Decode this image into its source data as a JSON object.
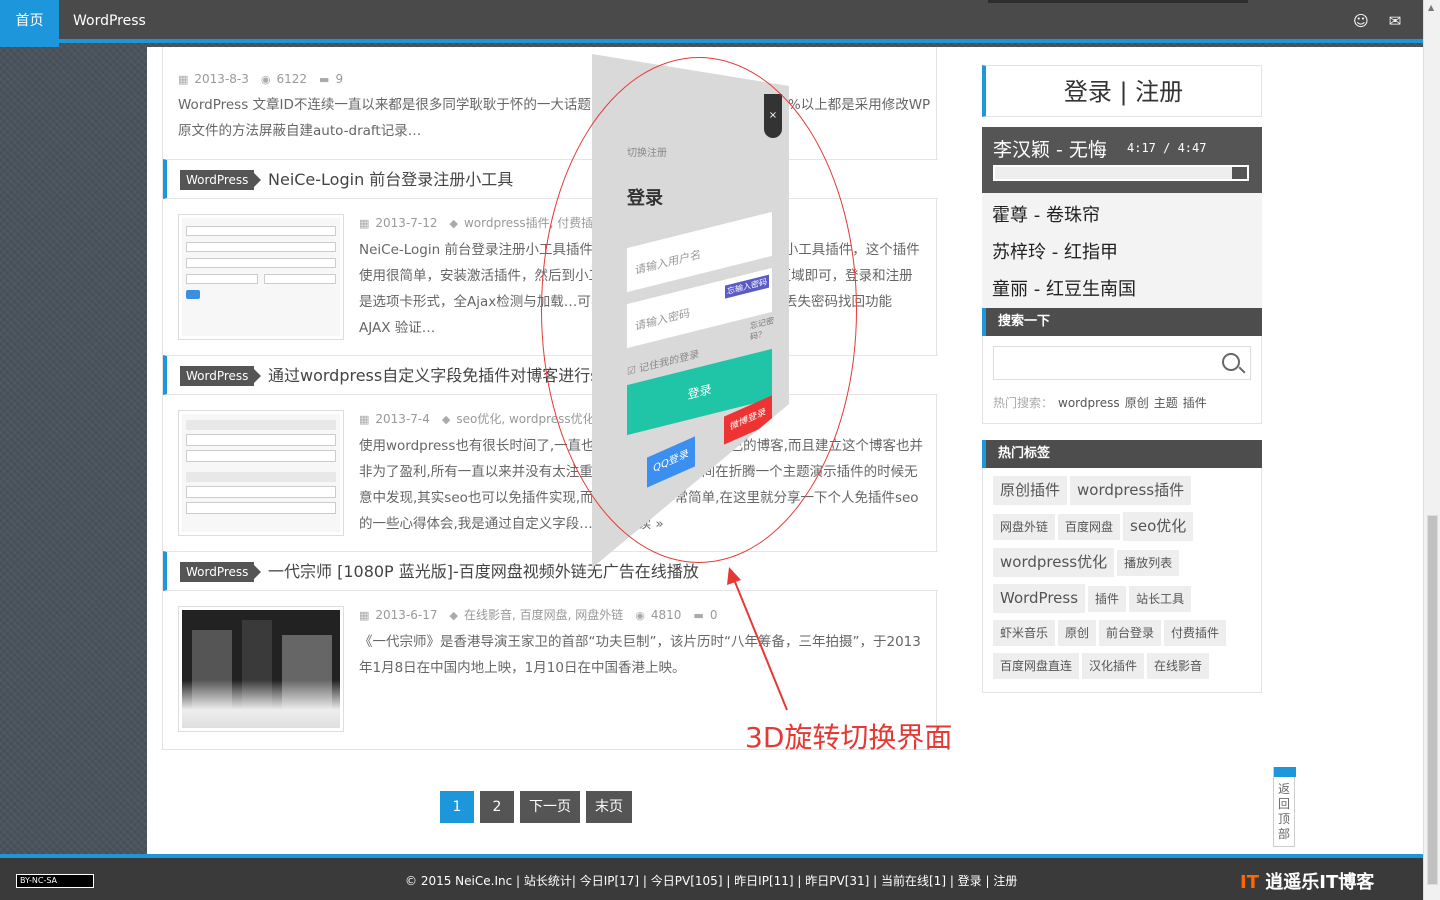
{
  "topbar": {
    "home": "首页",
    "brand": "WordPress"
  },
  "first_post": {
    "date": "2013-8-3",
    "views": "6122",
    "comments": "9",
    "excerpt": "WordPress 文章ID不连续一直以来都是很多同学耿耿于怀的一大话题，解决的方法有很多,但是几乎90%以上都是采用修改WP原文件的方法屏蔽自建auto-draft记录…"
  },
  "posts": [
    {
      "cat": "WordPress",
      "title": "NeiCe-Login 前台登录注册小工具",
      "date": "2013-7-12",
      "tags": "wordpress插件, 付费插件",
      "excerpt": "NeiCe-Login 前台登录注册小工具插件是一款WordPress前台登录注册小工具插件，这个插件使用很简单，安装激活插件，然后到小工具拖入NeiCe-Login到侧边栏区域即可，登录和注册是选项卡形式，全Ajax检测与加载…可实现小工具登录和注册切换功能 丢失密码找回功能 AJAX 验证…"
    },
    {
      "cat": "WordPress",
      "title": "通过wordpress自定义字段免插件对博客进行seo优化",
      "date": "2013-7-4",
      "tags": "seo优化, wordpress优化",
      "excerpt": "使用wordpress也有很长时间了,一直也没有很认真的去经营自己的博客,而且建立这个博客也并非为了盈利,所有一直以来并没有太注重seo优化,大部分时间在折腾一个主题演示插件的时候无意中发现,其实seo也可以免插件实现,而且实现起来非常简单,在这里就分享一下个人免插件seo的一些心得体会,我是通过自定义字段… 继续阅读 »"
    },
    {
      "cat": "WordPress",
      "title": "一代宗师 [1080P 蓝光版]-百度网盘视频外链无广告在线播放",
      "date": "2013-6-17",
      "tags": "在线影音, 百度网盘, 网盘外链",
      "views": "4810",
      "comments": "0",
      "excerpt": "《一代宗师》是香港导演王家卫的首部“功夫巨制”，该片历时“八年筹备，三年拍摄”，于2013年1月8日在中国内地上映，1月10日在中国香港上映。"
    }
  ],
  "pager": [
    "1",
    "2",
    "下一页",
    "末页"
  ],
  "sidebar": {
    "login": "登录 | 注册",
    "player": {
      "now": "李汉颖 - 无悔",
      "time": "4:17 / 4:47",
      "progress": 0.94,
      "list": [
        "霍尊 - 卷珠帘",
        "苏梓玲 - 红指甲",
        "童丽 - 红豆生南国"
      ]
    },
    "search_title": "搜索一下",
    "hot_label": "热门搜索：",
    "hot": [
      "wordpress",
      "原创",
      "主题",
      "插件"
    ],
    "tags_title": "热门标签",
    "tags": [
      {
        "t": "原创插件",
        "big": true
      },
      {
        "t": "wordpress插件",
        "big": true
      },
      {
        "t": "网盘外链"
      },
      {
        "t": "百度网盘"
      },
      {
        "t": "seo优化",
        "big": true
      },
      {
        "t": "wordpress优化",
        "big": true
      },
      {
        "t": "播放列表"
      },
      {
        "t": "WordPress",
        "big": true
      },
      {
        "t": "插件"
      },
      {
        "t": "站长工具"
      },
      {
        "t": "虾米音乐"
      },
      {
        "t": "原创"
      },
      {
        "t": "前台登录"
      },
      {
        "t": "付费插件"
      },
      {
        "t": "百度网盘直连"
      },
      {
        "t": "汉化插件"
      },
      {
        "t": "在线影音"
      }
    ]
  },
  "login_panel": {
    "switch": "切换注册",
    "title": "登录",
    "user_ph": "请输入用户名",
    "pass_ph": "请输入密码",
    "pass_btn": "忘输入密码",
    "forgot": "忘记密码？",
    "remember": "记住我的登录",
    "submit": "登录",
    "qq": "QQ登录",
    "weibo": "微博登录",
    "close": "×"
  },
  "annotation": "3D旋转切换界面",
  "back_top": "返回顶部",
  "footer": {
    "cc": "BY-NC-SA",
    "text": "© 2015 NeiCe.Inc | 站长统计| 今日IP[17] | 今日PV[105] | 昨日IP[11] | 昨日PV[31] | 当前在线[1] | 登录 | 注册",
    "logo_a": "IT",
    "logo_b": "逍遥乐IT博客"
  }
}
